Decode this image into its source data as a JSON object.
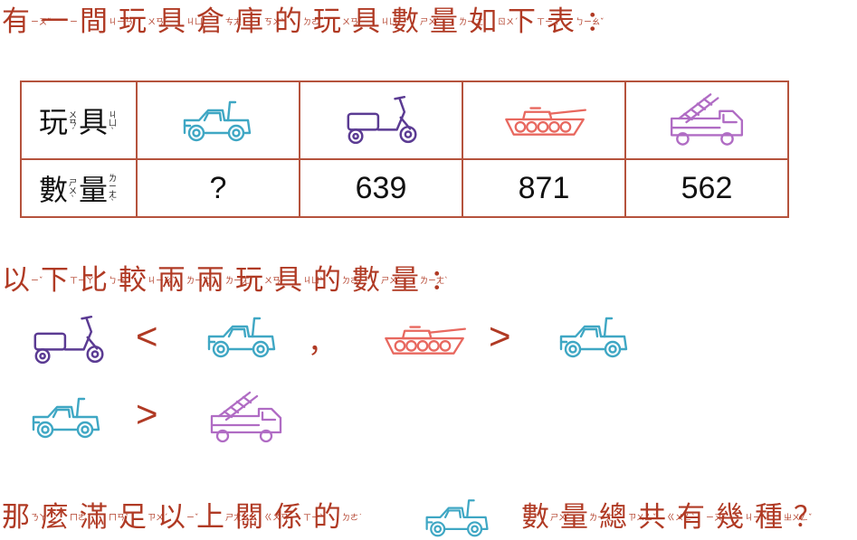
{
  "question_intro": "有一間玩具倉庫的玩具數量如下表：",
  "question_intro_zhuyin": [
    "ㄧㄡˇ",
    "ㄧ",
    "ㄐㄧㄢ",
    "ㄨㄢˊ",
    "ㄐㄩˋ",
    "ㄘㄤ",
    "ㄎㄨˋ",
    "ㄉㄜ˙",
    "ㄨㄢˊ",
    "ㄐㄩˋ",
    "ㄕㄨˋ",
    "ㄌㄧㄤˋ",
    "ㄖㄨˊ",
    "ㄒㄧㄚˋ",
    "ㄅㄧㄠˇ"
  ],
  "table": {
    "row1_header": "玩具",
    "row1_header_zhuyin": [
      "ㄨㄢˊ",
      "ㄐㄩˋ"
    ],
    "row2_header": "數量",
    "row2_header_zhuyin": [
      "ㄕㄨˋ",
      "ㄌㄧㄤˋ"
    ],
    "toys": [
      {
        "icon": "jeep-icon",
        "color": "#3fa7c4",
        "count": "?"
      },
      {
        "icon": "scooter-icon",
        "color": "#5b3b93",
        "count": "639"
      },
      {
        "icon": "tank-icon",
        "color": "#e8685f",
        "count": "871"
      },
      {
        "icon": "fire-truck-icon",
        "color": "#b06cc4",
        "count": "562"
      }
    ]
  },
  "compare_intro": "以下比較兩兩玩具的數量：",
  "compare_intro_zhuyin": [
    "ㄧˇ",
    "ㄒㄧㄚˋ",
    "ㄅㄧˇ",
    "ㄐㄧㄠˋ",
    "ㄌㄧㄤˇ",
    "ㄌㄧㄤˇ",
    "ㄨㄢˊ",
    "ㄐㄩˋ",
    "ㄉㄜ˙",
    "ㄕㄨˋ",
    "ㄌㄧㄤˋ"
  ],
  "comparisons": {
    "c1_sign": "<",
    "separator": "，",
    "c2_sign": ">",
    "c3_sign": ">"
  },
  "final_question": {
    "part1": "那麼滿足以上關係的",
    "part1_zhuyin": [
      "ㄋㄚˋ",
      "ㄇㄜ˙",
      "ㄇㄢˇ",
      "ㄗㄨˊ",
      "ㄧˇ",
      "ㄕㄤˋ",
      "ㄍㄨㄢ",
      "ㄒㄧˋ",
      "ㄉㄜ˙"
    ],
    "part2": "數量總共有幾種？",
    "part2_zhuyin": [
      "ㄕㄨˋ",
      "ㄌㄧㄤˋ",
      "ㄗㄨㄥˇ",
      "ㄍㄨㄥˋ",
      "ㄧㄡˇ",
      "ㄐㄧˇ",
      "ㄓㄨㄥˇ"
    ]
  },
  "colors": {
    "text": "#b03a24",
    "table_border": "#b5533d",
    "jeep": "#3fa7c4",
    "scooter": "#5b3b93",
    "tank": "#e8685f",
    "fire_truck": "#b06cc4"
  }
}
